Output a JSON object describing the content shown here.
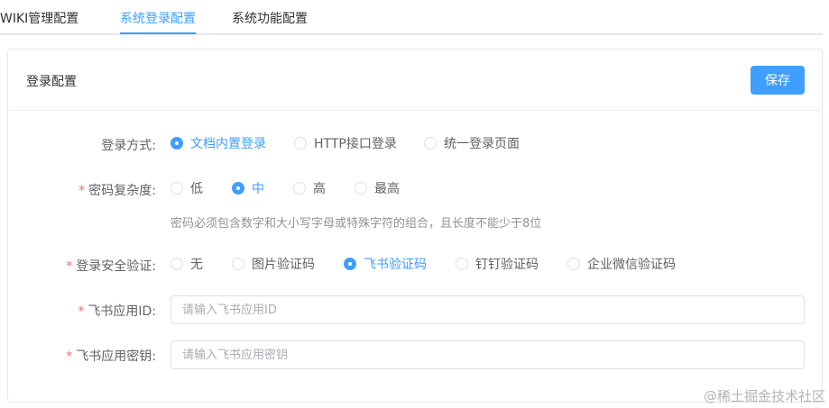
{
  "tabs": [
    {
      "label": "WIKI管理配置"
    },
    {
      "label": "系统登录配置"
    },
    {
      "label": "系统功能配置"
    }
  ],
  "card": {
    "title": "登录配置",
    "save_label": "保存"
  },
  "form": {
    "login_method": {
      "label": "登录方式:",
      "options": [
        "文档内置登录",
        "HTTP接口登录",
        "统一登录页面"
      ],
      "selected": "文档内置登录"
    },
    "password_complexity": {
      "required_mark": "*",
      "label": "密码复杂度:",
      "options": [
        "低",
        "中",
        "高",
        "最高"
      ],
      "selected": "中",
      "hint": "密码必须包含数字和大小写字母或特殊字符的组合，且长度不能少于8位"
    },
    "login_verification": {
      "required_mark": "*",
      "label": "登录安全验证:",
      "options": [
        "无",
        "图片验证码",
        "飞书验证码",
        "钉钉验证码",
        "企业微信验证码"
      ],
      "selected": "飞书验证码"
    },
    "feishu_app_id": {
      "required_mark": "*",
      "label": "飞书应用ID:",
      "value": "",
      "placeholder": "请输入飞书应用ID"
    },
    "feishu_app_secret": {
      "required_mark": "*",
      "label": "飞书应用密钥:",
      "value": "",
      "placeholder": "请输入飞书应用密钥"
    }
  },
  "watermark": "@稀土掘金技术社区",
  "colors": {
    "accent": "#409eff",
    "required": "#f56c6c",
    "hint": "#909399"
  }
}
